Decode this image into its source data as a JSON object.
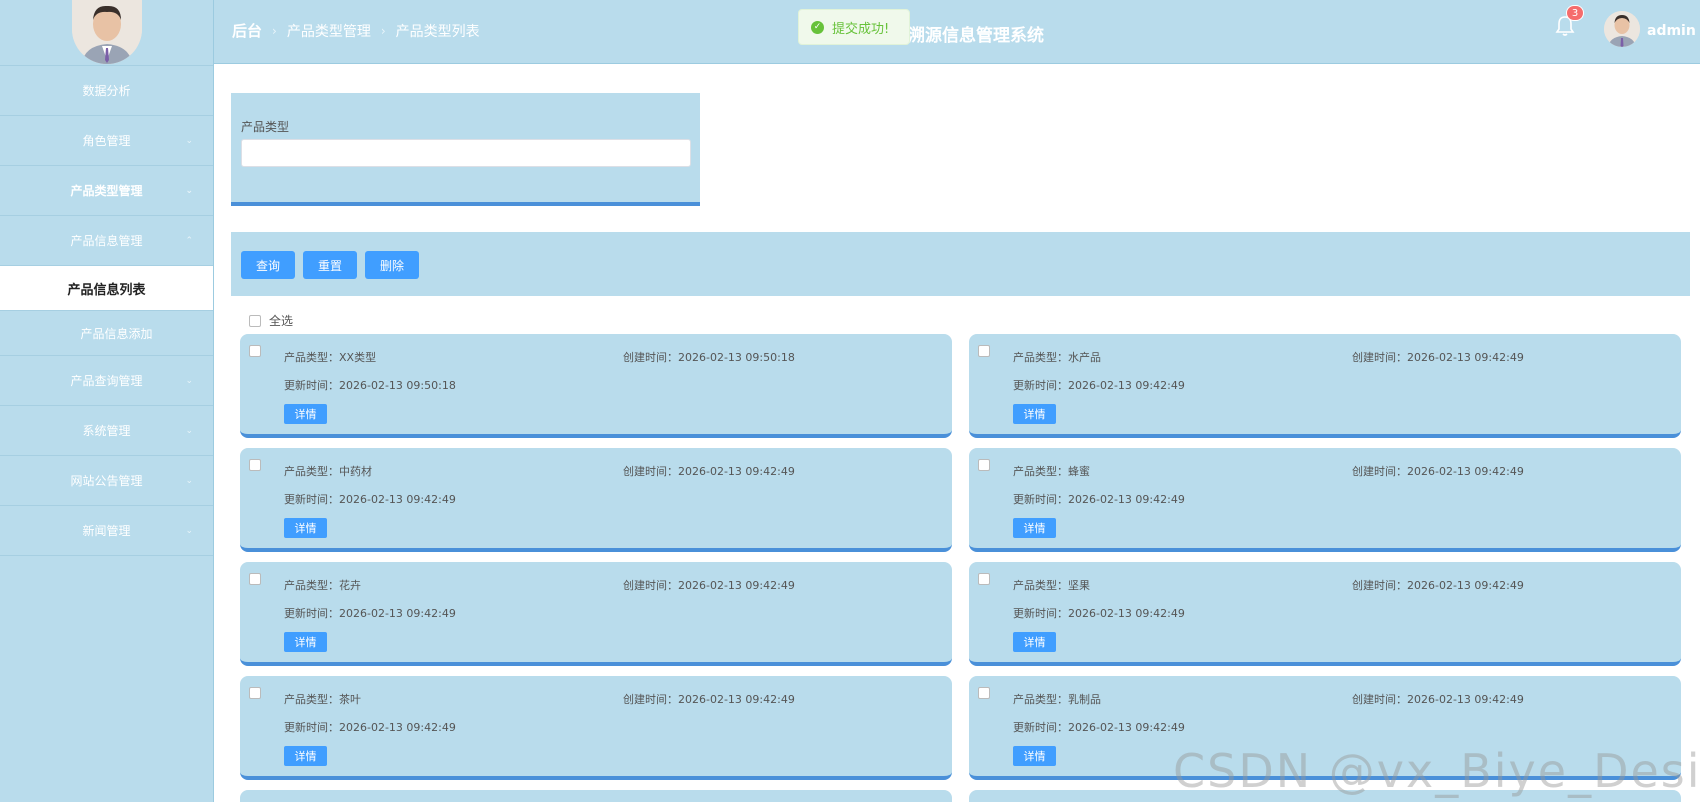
{
  "sidebar": {
    "menu": [
      {
        "label": "数据分析",
        "chevron": false
      },
      {
        "label": "角色管理",
        "chevron": true
      },
      {
        "label": "产品类型管理",
        "chevron": true
      },
      {
        "label": "产品信息管理",
        "chevron": true,
        "expanded": true
      }
    ],
    "sub": [
      {
        "label": "产品信息列表",
        "active": true
      },
      {
        "label": "产品信息添加",
        "active": false
      }
    ],
    "menu2": [
      {
        "label": "产品查询管理"
      },
      {
        "label": "系统管理"
      },
      {
        "label": "网站公告管理"
      },
      {
        "label": "新闻管理"
      }
    ]
  },
  "header": {
    "breadcrumb": [
      "后台",
      "产品类型管理",
      "产品类型列表"
    ],
    "system_title": "溯源信息管理系统",
    "toast": "提交成功!",
    "notification_count": "3",
    "username": "admin"
  },
  "search": {
    "label": "产品类型",
    "value": ""
  },
  "actions": {
    "query": "查询",
    "reset": "重置",
    "delete": "删除"
  },
  "select_all": "全选",
  "cards": [
    {
      "type": "产品类型：XX类型",
      "created": "创建时间：2026-02-13 09:50:18",
      "updated": "更新时间：2026-02-13 09:50:18",
      "detail": "详情"
    },
    {
      "type": "产品类型：水产品",
      "created": "创建时间：2026-02-13 09:42:49",
      "updated": "更新时间：2026-02-13 09:42:49",
      "detail": "详情"
    },
    {
      "type": "产品类型：中药材",
      "created": "创建时间：2026-02-13 09:42:49",
      "updated": "更新时间：2026-02-13 09:42:49",
      "detail": "详情"
    },
    {
      "type": "产品类型：蜂蜜",
      "created": "创建时间：2026-02-13 09:42:49",
      "updated": "更新时间：2026-02-13 09:42:49",
      "detail": "详情"
    },
    {
      "type": "产品类型：花卉",
      "created": "创建时间：2026-02-13 09:42:49",
      "updated": "更新时间：2026-02-13 09:42:49",
      "detail": "详情"
    },
    {
      "type": "产品类型：坚果",
      "created": "创建时间：2026-02-13 09:42:49",
      "updated": "更新时间：2026-02-13 09:42:49",
      "detail": "详情"
    },
    {
      "type": "产品类型：茶叶",
      "created": "创建时间：2026-02-13 09:42:49",
      "updated": "更新时间：2026-02-13 09:42:49",
      "detail": "详情"
    },
    {
      "type": "产品类型：乳制品",
      "created": "创建时间：2026-02-13 09:42:49",
      "updated": "更新时间：2026-02-13 09:42:49",
      "detail": "详情"
    }
  ],
  "watermark": "CSDN @vx_Biye_Design",
  "colors": {
    "panel": "#b9dcec",
    "accent": "#4a90d9",
    "button": "#409eff",
    "success": "#67c23a",
    "badge": "#f56c6c"
  }
}
